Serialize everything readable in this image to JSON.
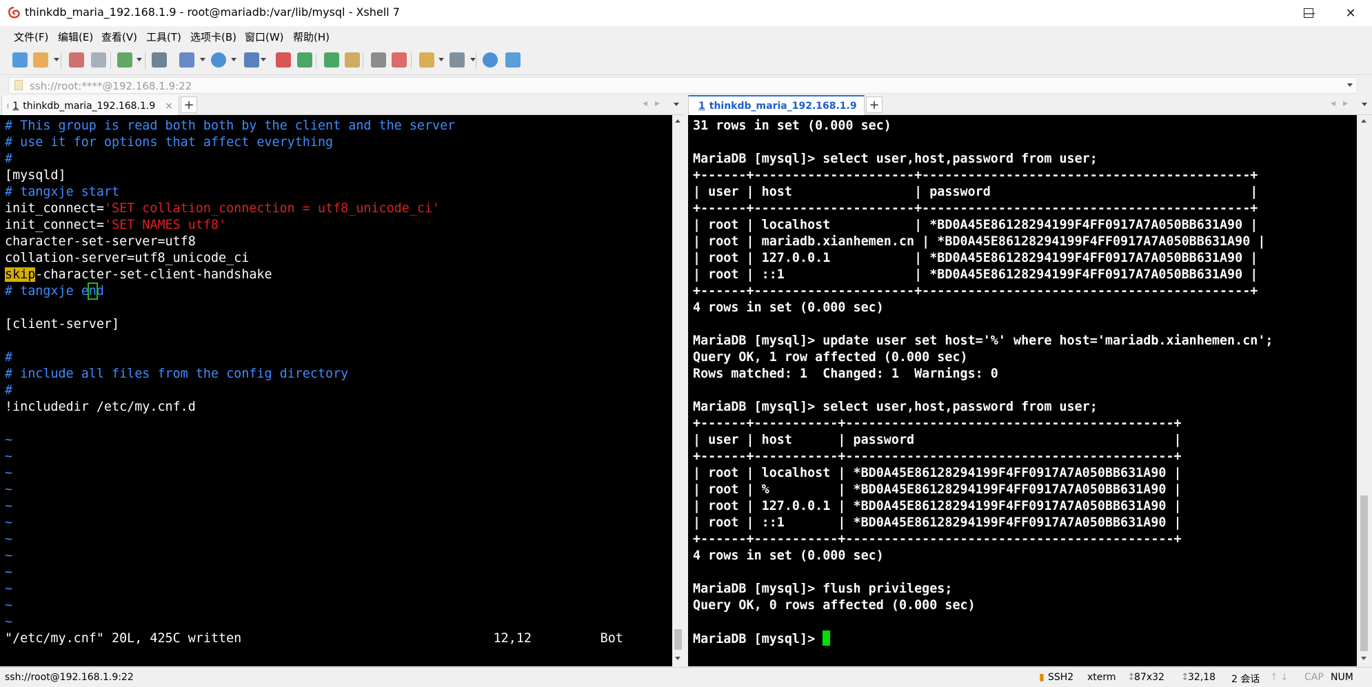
{
  "window": {
    "title": "thinkdb_maria_192.168.1.9 - root@mariadb:/var/lib/mysql - Xshell 7",
    "min_glyph": "—",
    "max_glyph": "☐",
    "close_glyph": "✕"
  },
  "menu": [
    "文件(F)",
    "编辑(E)",
    "查看(V)",
    "工具(T)",
    "选项卡(B)",
    "窗口(W)",
    "帮助(H)"
  ],
  "address": {
    "text": "ssh://root:****@192.168.1.9:22"
  },
  "toolbar_icons": [
    {
      "name": "new-session-icon",
      "color": "#3a8bd8"
    },
    {
      "name": "open-folder-icon",
      "color": "#e6a23c"
    },
    {
      "name": "disconnect-icon",
      "color": "#c75a5a"
    },
    {
      "name": "reconnect-icon",
      "color": "#9aa6b2"
    },
    {
      "name": "session-props-icon",
      "color": "#4a9a4a"
    },
    {
      "name": "find-icon",
      "color": "#5a6e82"
    },
    {
      "name": "transfer-icon",
      "color": "#5277c2"
    },
    {
      "name": "globe-icon",
      "color": "#2f7fd1"
    },
    {
      "name": "font-icon",
      "color": "#3f6fb0"
    },
    {
      "name": "xftp-icon",
      "color": "#d23b3b"
    },
    {
      "name": "xmanager-icon",
      "color": "#2e9a4e"
    },
    {
      "name": "fullscreen-icon",
      "color": "#2e9a4e"
    },
    {
      "name": "lock-icon",
      "color": "#c7a04a"
    },
    {
      "name": "keyboard-icon",
      "color": "#7a7a7a"
    },
    {
      "name": "highlight-icon",
      "color": "#d9534f"
    },
    {
      "name": "compose-icon",
      "color": "#d4a437"
    },
    {
      "name": "layout-icon",
      "color": "#6f7f8f"
    },
    {
      "name": "help-icon",
      "color": "#2f7fd1"
    },
    {
      "name": "chat-icon",
      "color": "#3f8fd8"
    }
  ],
  "left_tab": {
    "number": "1",
    "label": "thinkdb_maria_192.168.1.9",
    "close": "×",
    "add": "+"
  },
  "right_tab": {
    "number": "1",
    "label": "thinkdb_maria_192.168.1.9",
    "close": "×",
    "add": "+"
  },
  "left_terminal": {
    "lines": [
      {
        "parts": [
          {
            "t": "# This group is read both both by the client and the server",
            "c": "blue"
          }
        ]
      },
      {
        "parts": [
          {
            "t": "# use it for options that affect everything",
            "c": "blue"
          }
        ]
      },
      {
        "parts": [
          {
            "t": "#",
            "c": "blue"
          }
        ]
      },
      {
        "parts": [
          {
            "t": "[mysqld]",
            "c": ""
          }
        ]
      },
      {
        "parts": [
          {
            "t": "# tangxje start",
            "c": "blue"
          }
        ]
      },
      {
        "parts": [
          {
            "t": "init_connect=",
            "c": ""
          },
          {
            "t": "'SET collation_connection = utf8_unicode_ci'",
            "c": "red"
          }
        ]
      },
      {
        "parts": [
          {
            "t": "init_connect=",
            "c": ""
          },
          {
            "t": "'SET NAMES utf8'",
            "c": "red"
          }
        ]
      },
      {
        "parts": [
          {
            "t": "character-set-server=utf8",
            "c": ""
          }
        ]
      },
      {
        "parts": [
          {
            "t": "collation-server=utf8_unicode_ci",
            "c": ""
          }
        ]
      },
      {
        "parts": [
          {
            "t": "skip",
            "c": "hl"
          },
          {
            "t": "-character-set-client-handshake",
            "c": ""
          }
        ]
      },
      {
        "parts": [
          {
            "t": "# tangxje e",
            "c": "blue"
          },
          {
            "t": "n",
            "c": "blue cur"
          },
          {
            "t": "d",
            "c": "blue"
          }
        ]
      },
      {
        "parts": [
          {
            "t": "",
            "c": ""
          }
        ]
      },
      {
        "parts": [
          {
            "t": "[client-server]",
            "c": ""
          }
        ]
      },
      {
        "parts": [
          {
            "t": "",
            "c": ""
          }
        ]
      },
      {
        "parts": [
          {
            "t": "#",
            "c": "blue"
          }
        ]
      },
      {
        "parts": [
          {
            "t": "# include all files from the config directory",
            "c": "blue"
          }
        ]
      },
      {
        "parts": [
          {
            "t": "#",
            "c": "blue"
          }
        ]
      },
      {
        "parts": [
          {
            "t": "!includedir /etc/my.cnf.d",
            "c": ""
          }
        ]
      },
      {
        "parts": [
          {
            "t": "",
            "c": ""
          }
        ]
      },
      {
        "parts": [
          {
            "t": "~",
            "c": "blue"
          }
        ]
      },
      {
        "parts": [
          {
            "t": "~",
            "c": "blue"
          }
        ]
      },
      {
        "parts": [
          {
            "t": "~",
            "c": "blue"
          }
        ]
      },
      {
        "parts": [
          {
            "t": "~",
            "c": "blue"
          }
        ]
      },
      {
        "parts": [
          {
            "t": "~",
            "c": "blue"
          }
        ]
      },
      {
        "parts": [
          {
            "t": "~",
            "c": "blue"
          }
        ]
      },
      {
        "parts": [
          {
            "t": "~",
            "c": "blue"
          }
        ]
      },
      {
        "parts": [
          {
            "t": "~",
            "c": "blue"
          }
        ]
      },
      {
        "parts": [
          {
            "t": "~",
            "c": "blue"
          }
        ]
      },
      {
        "parts": [
          {
            "t": "~",
            "c": "blue"
          }
        ]
      },
      {
        "parts": [
          {
            "t": "~",
            "c": "blue"
          }
        ]
      },
      {
        "parts": [
          {
            "t": "~",
            "c": "blue"
          }
        ]
      },
      {
        "parts": [
          {
            "t": "\"/etc/my.cnf\" 20L, 425C written                                 12,12         Bot",
            "c": ""
          }
        ]
      }
    ]
  },
  "right_terminal": {
    "lines": [
      "31 rows in set (0.000 sec)",
      "",
      "MariaDB [mysql]> select user,host,password from user;",
      "+------+---------------------+-------------------------------------------+",
      "| user | host                | password                                  |",
      "+------+---------------------+-------------------------------------------+",
      "| root | localhost           | *BD0A45E86128294199F4FF0917A7A050BB631A90 |",
      "| root | mariadb.xianhemen.cn | *BD0A45E86128294199F4FF0917A7A050BB631A90 |",
      "| root | 127.0.0.1           | *BD0A45E86128294199F4FF0917A7A050BB631A90 |",
      "| root | ::1                 | *BD0A45E86128294199F4FF0917A7A050BB631A90 |",
      "+------+---------------------+-------------------------------------------+",
      "4 rows in set (0.000 sec)",
      "",
      "MariaDB [mysql]> update user set host='%' where host='mariadb.xianhemen.cn';",
      "Query OK, 1 row affected (0.000 sec)",
      "Rows matched: 1  Changed: 1  Warnings: 0",
      "",
      "MariaDB [mysql]> select user,host,password from user;",
      "+------+-----------+-------------------------------------------+",
      "| user | host      | password                                  |",
      "+------+-----------+-------------------------------------------+",
      "| root | localhost | *BD0A45E86128294199F4FF0917A7A050BB631A90 |",
      "| root | %         | *BD0A45E86128294199F4FF0917A7A050BB631A90 |",
      "| root | 127.0.0.1 | *BD0A45E86128294199F4FF0917A7A050BB631A90 |",
      "| root | ::1       | *BD0A45E86128294199F4FF0917A7A050BB631A90 |",
      "+------+-----------+-------------------------------------------+",
      "4 rows in set (0.000 sec)",
      "",
      "MariaDB [mysql]> flush privileges;",
      "Query OK, 0 rows affected (0.000 sec)",
      "",
      "MariaDB [mysql]> "
    ]
  },
  "statusbar": {
    "connection": "ssh://root@192.168.1.9:22",
    "protocol": "SSH2",
    "term": "xterm",
    "size": "87x32",
    "cursor": "32,18",
    "sessions": "2 会话",
    "cap": "CAP",
    "num": "NUM"
  }
}
